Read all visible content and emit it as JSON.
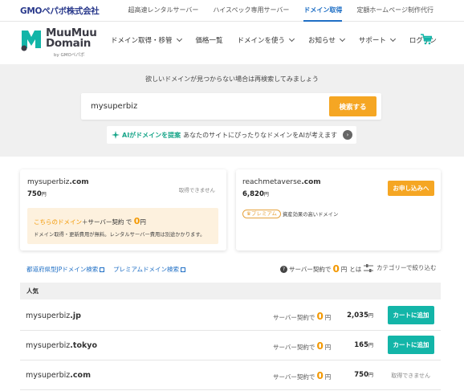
{
  "topbar": {
    "brand": "GMOペパボ株式会社",
    "links": [
      "超高速レンタルサーバー",
      "ハイスペック専用サーバー",
      "ドメイン取得",
      "定額ホームページ制作代行"
    ],
    "active_index": 2
  },
  "header": {
    "logo_line1": "MuuMuu",
    "logo_line2": "Domain",
    "logo_sub": "by GMOペパボ",
    "nav": [
      {
        "label": "ドメイン取得・移管",
        "dropdown": true
      },
      {
        "label": "価格一覧",
        "dropdown": false
      },
      {
        "label": "ドメインを使う",
        "dropdown": true
      },
      {
        "label": "お知らせ",
        "dropdown": true
      },
      {
        "label": "サポート",
        "dropdown": true
      },
      {
        "label": "ログイン",
        "dropdown": false
      }
    ],
    "cart_icon": "cart-icon"
  },
  "search": {
    "hint": "欲しいドメインが見つからない場合は再検索してみましょう",
    "value": "mysuperbiz",
    "button_label": "検索する",
    "ai_label": "AIがドメインを提案",
    "ai_text": "あなたのサイトにぴったりなドメインをAIが考えます"
  },
  "cards": {
    "primary": {
      "name": "mysuperbiz",
      "tld": ".com",
      "price": "750",
      "unit": "円",
      "status": "取得できません",
      "promo_prefix": "こちらのドメイン",
      "promo_mid": "＋サーバー契約 で",
      "promo_zero": "0",
      "promo_unit": "円",
      "promo_note": "ドメイン取得・更新費用が無料。レンタルサーバー費用は別途かかります。"
    },
    "premium": {
      "name": "reachmetaverse",
      "tld": ".com",
      "price": "6,820",
      "unit": "円",
      "button_label": "お申し込みへ",
      "badge": "プレミアム",
      "note": "資産効果の高いドメイン"
    }
  },
  "links": {
    "jp_search": "都道府県型JPドメイン検索",
    "premium_search": "プレミアムドメイン検索",
    "server_prefix": "サーバー契約で",
    "server_zero": "0",
    "server_unit": "円",
    "server_suffix": "とは",
    "filter": "カテゴリーで絞り込む"
  },
  "popular": {
    "heading": "人気",
    "server_text": "サーバー契約で",
    "zero": "0",
    "zero_unit": "円",
    "price_unit": "円",
    "add_label": "カートに追加",
    "rows": [
      {
        "name": "mysuperbiz",
        "tld": ".jp",
        "price": "2,035",
        "available": true,
        "na_text": ""
      },
      {
        "name": "mysuperbiz",
        "tld": ".tokyo",
        "price": "165",
        "available": true,
        "na_text": ""
      },
      {
        "name": "mysuperbiz",
        "tld": ".com",
        "price": "750",
        "available": false,
        "na_text": "取得できません"
      }
    ]
  },
  "colors": {
    "orange": "#f5a623",
    "teal": "#13b5a8",
    "blue_link": "#1f6fc5",
    "band_bg": "#f0f0f0"
  }
}
